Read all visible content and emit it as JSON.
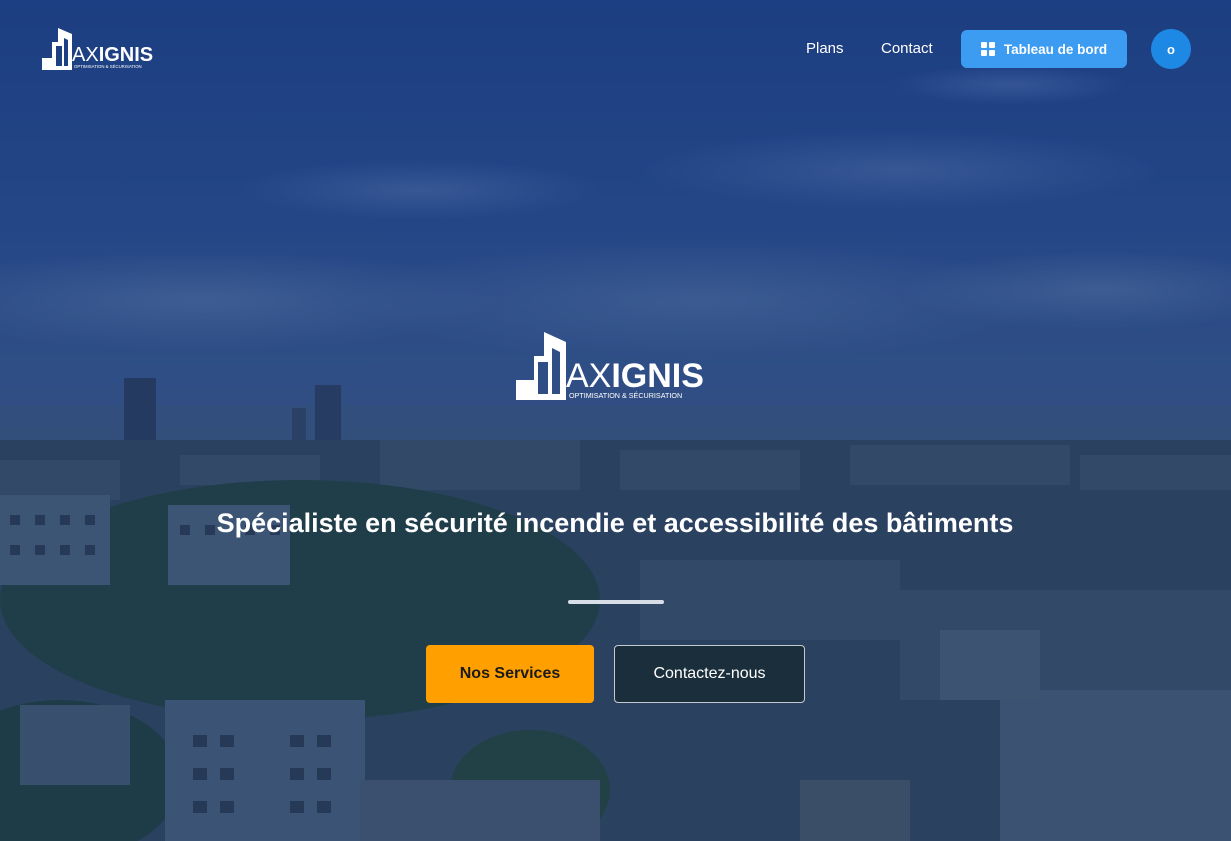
{
  "brand": {
    "name_light": "AX",
    "name_bold": "IGNIS",
    "tagline_small": "OPTIMISATION & SÉCURISATION",
    "logo_icon": "building-logo-icon"
  },
  "nav": {
    "links": [
      {
        "label": "Plans"
      },
      {
        "label": "Contact"
      }
    ],
    "dashboard_label": "Tableau de bord",
    "dashboard_icon": "dashboard-grid-icon",
    "avatar_initial": "o"
  },
  "hero": {
    "tagline_part1": "Spécialiste en ",
    "tagline_bold1": "sécurité incendie",
    "tagline_part2": " et ",
    "tagline_bold2": "accessibilité des bâtiments",
    "primary_button": "Nos Services",
    "secondary_button": "Contactez-nous"
  },
  "colors": {
    "primary_button": "#ffa000",
    "dashboard_button": "#3b9cf2",
    "avatar": "#1e88e5"
  }
}
